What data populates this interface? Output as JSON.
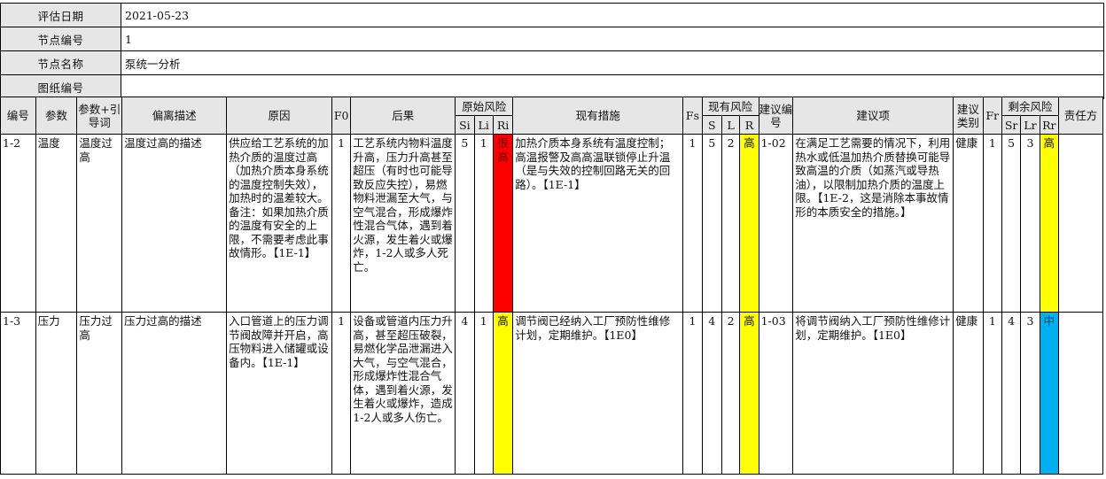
{
  "info": {
    "date_label": "评估日期",
    "date_value": "2021-05-23",
    "node_no_label": "节点编号",
    "node_no_value": "1",
    "node_name_label": "节点名称",
    "node_name_value": "泵统一分析",
    "drawing_label": "图纸编号",
    "drawing_value": ""
  },
  "headers": {
    "no": "编号",
    "param": "参数",
    "guide": "参数+引导词",
    "deviation": "偏离描述",
    "cause": "原因",
    "f0": "F0",
    "consequence": "后果",
    "orig_risk": "原始风险",
    "si": "Si",
    "li": "Li",
    "ri": "Ri",
    "measures": "现有措施",
    "fs": "Fs",
    "cur_risk": "现有风险",
    "s": "S",
    "l": "L",
    "r": "R",
    "rec_no": "建议编号",
    "rec": "建议项",
    "rec_type": "建议类别",
    "fr": "Fr",
    "res_risk": "剩余风险",
    "sr": "Sr",
    "lr": "Lr",
    "rr": "Rr",
    "owner": "责任方"
  },
  "rows": [
    {
      "no": "1-2",
      "param": "温度",
      "guide": "温度过高",
      "deviation": "温度过高的描述",
      "cause": "供应给工艺系统的加热介质的温度过高（加热介质本身系统的温度控制失效），加热时的温差较大。备注：如果加热介质的温度有安全的上限，不需要考虑此事故情形。【1E-1】",
      "f0": "1",
      "consequence": "工艺系统内物料温度升高，压力升高甚至超压（有时也可能导致反应失控），易燃物料泄漏至大气，与空气混合，形成爆炸性混合气体，遇到着火源，发生着火或爆炸，1-2人或多人死亡。",
      "si": "5",
      "li": "1",
      "ri": "很高",
      "ri_color": "#ff0000",
      "measures": "加热介质本身系统有温度控制；高温报警及高高温联锁停止升温（是与失效的控制回路无关的回路）。【1E-1】",
      "fs": "1",
      "s": "5",
      "l": "2",
      "r": "高",
      "r_color": "#ffff00",
      "rec_no": "1-02",
      "rec": "在满足工艺需要的情况下，利用热水或低温加热介质替换可能导致高温的介质（如蒸汽或导热油），以限制加热介质的温度上限。【1E-2，这是消除本事故情形的本质安全的措施。】",
      "rec_type": "健康",
      "fr": "1",
      "sr": "5",
      "lr": "3",
      "rr": "高",
      "rr_color": "#ffff00",
      "owner": ""
    },
    {
      "no": "1-3",
      "param": "压力",
      "guide": "压力过高",
      "deviation": "压力过高的描述",
      "cause": "入口管道上的压力调节阀故障并开启，高压物料进入储罐或设备内。【1E-1】",
      "f0": "1",
      "consequence": "设备或管道内压力升高，甚至超压破裂，易燃化学品泄漏进入大气，与空气混合，形成爆炸性混合气体，遇到着火源，发生着火或爆炸，造成1-2人或多人伤亡。",
      "si": "4",
      "li": "1",
      "ri": "高",
      "ri_color": "#ffff00",
      "measures": "调节阀已经纳入工厂预防性维修计划，定期维护。【1E0】",
      "fs": "1",
      "s": "4",
      "l": "2",
      "r": "高",
      "r_color": "#ffff00",
      "rec_no": "1-03",
      "rec": "将调节阀纳入工厂预防性维修计划，定期维护。【1E0】",
      "rec_type": "健康",
      "fr": "1",
      "sr": "4",
      "lr": "3",
      "rr": "中",
      "rr_color": "#00b0f0",
      "owner": ""
    }
  ]
}
